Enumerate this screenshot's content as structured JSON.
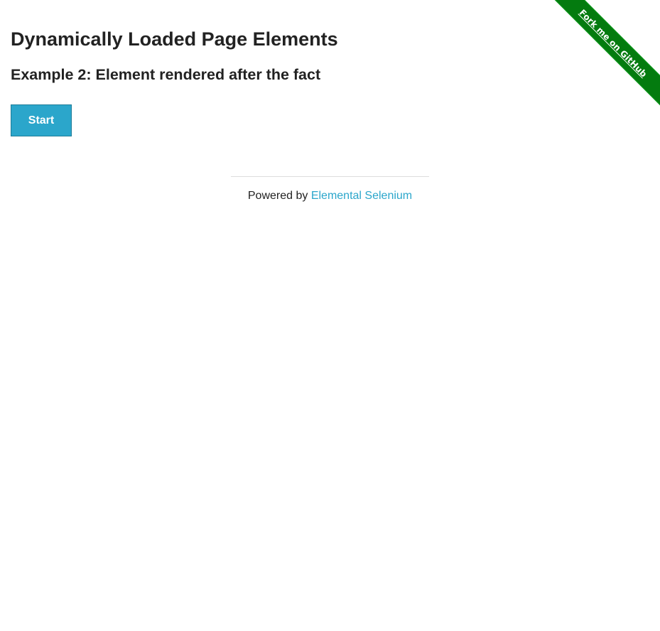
{
  "ribbon": {
    "label": "Fork me on GitHub",
    "color": "#047b0f"
  },
  "page": {
    "title": "Dynamically Loaded Page Elements",
    "subtitle": "Example 2: Element rendered after the fact"
  },
  "start_button": {
    "label": "Start",
    "color": "#2ba6cb"
  },
  "footer": {
    "prefix": "Powered by",
    "link_label": "Elemental Selenium",
    "link_color": "#2ba6cb"
  }
}
